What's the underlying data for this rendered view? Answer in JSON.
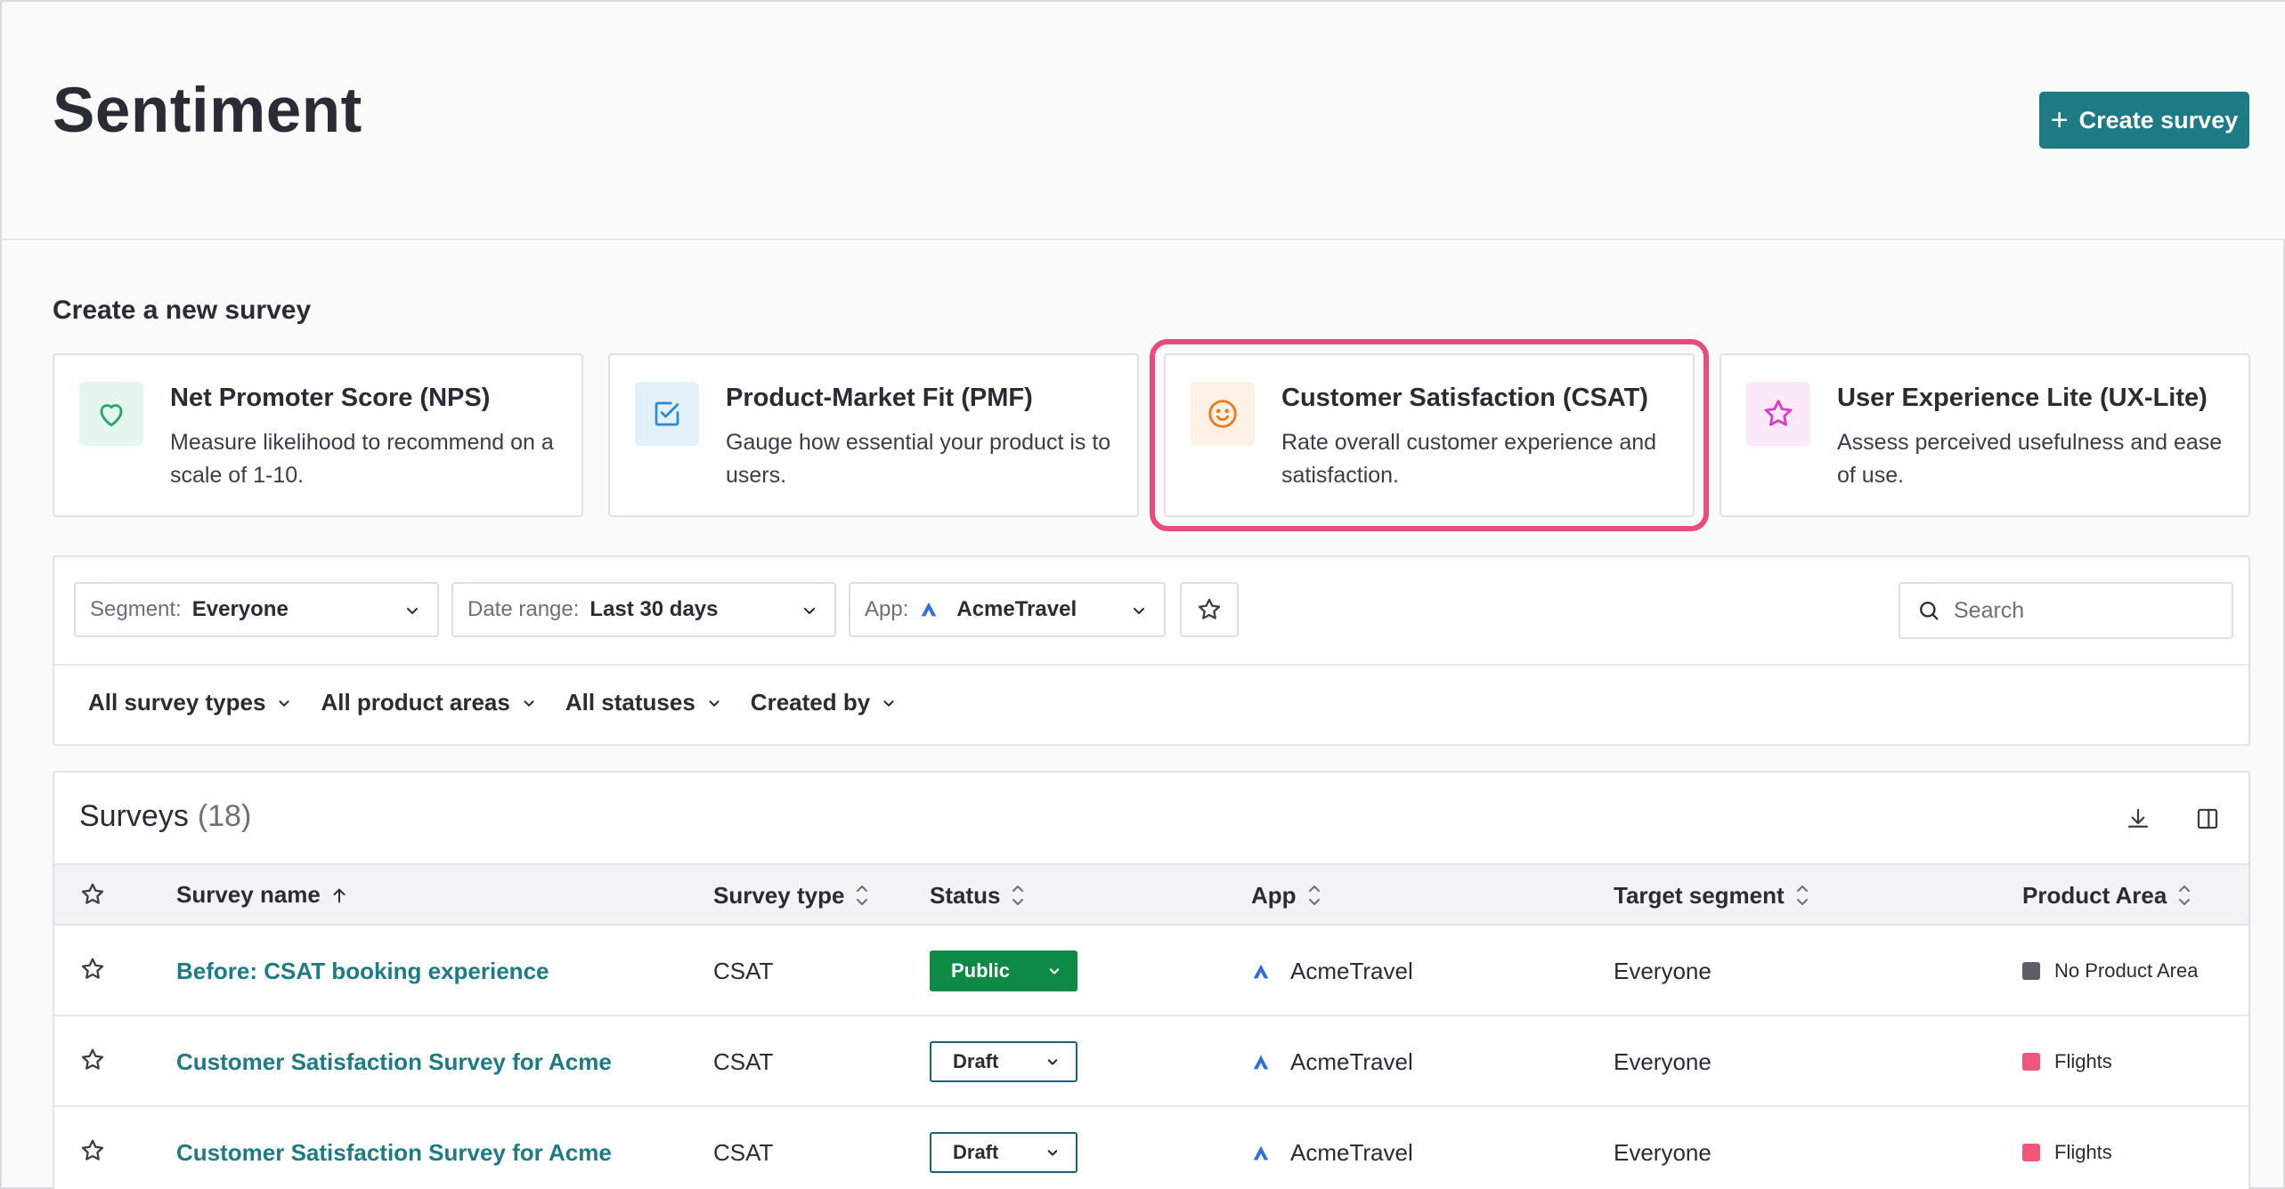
{
  "page": {
    "title": "Sentiment",
    "create_button": "Create survey"
  },
  "templates": {
    "heading": "Create a new survey",
    "cards": [
      {
        "title": "Net Promoter Score (NPS)",
        "desc": "Measure likelihood to recommend on a scale of 1-10.",
        "icon": "heart-icon",
        "color": "#1fa86a",
        "bg": "#e6f6ee"
      },
      {
        "title": "Product-Market Fit (PMF)",
        "desc": "Gauge how essential your product is to users.",
        "icon": "checkbox-icon",
        "color": "#2b8ad6",
        "bg": "#e3f1fb"
      },
      {
        "title": "Customer Satisfaction (CSAT)",
        "desc": "Rate overall customer experience and satisfaction.",
        "icon": "smiley-icon",
        "color": "#f07a1a",
        "bg": "#fdf0e4"
      },
      {
        "title": "User Experience Lite (UX-Lite)",
        "desc": "Assess perceived usefulness and ease of use.",
        "icon": "star-icon",
        "color": "#d33fc9",
        "bg": "#fbe8f8"
      }
    ]
  },
  "filters": {
    "segment_label": "Segment:",
    "segment_value": "Everyone",
    "date_label": "Date range:",
    "date_value": "Last 30 days",
    "app_label": "App:",
    "app_value": "AcmeTravel",
    "search_placeholder": "Search",
    "pills": [
      "All survey types",
      "All product areas",
      "All statuses",
      "Created by"
    ]
  },
  "table": {
    "title": "Surveys",
    "count": "(18)",
    "columns": {
      "name": "Survey name",
      "type": "Survey type",
      "status": "Status",
      "app": "App",
      "segment": "Target segment",
      "area": "Product Area"
    },
    "rows": [
      {
        "name": "Before: CSAT booking experience",
        "type": "CSAT",
        "status": "Public",
        "status_kind": "public",
        "app": "AcmeTravel",
        "segment": "Everyone",
        "area": "No Product Area",
        "area_color": "#5d5f66"
      },
      {
        "name": "Customer Satisfaction Survey for Acme",
        "type": "CSAT",
        "status": "Draft",
        "status_kind": "draft",
        "app": "AcmeTravel",
        "segment": "Everyone",
        "area": "Flights",
        "area_color": "#f0557b"
      },
      {
        "name": "Customer Satisfaction Survey for Acme",
        "type": "CSAT",
        "status": "Draft",
        "status_kind": "draft",
        "app": "AcmeTravel",
        "segment": "Everyone",
        "area": "Flights",
        "area_color": "#f0557b"
      }
    ]
  },
  "colors": {
    "accent": "#1d7b86",
    "highlight": "#ec4a7d",
    "public": "#0d8a43"
  }
}
